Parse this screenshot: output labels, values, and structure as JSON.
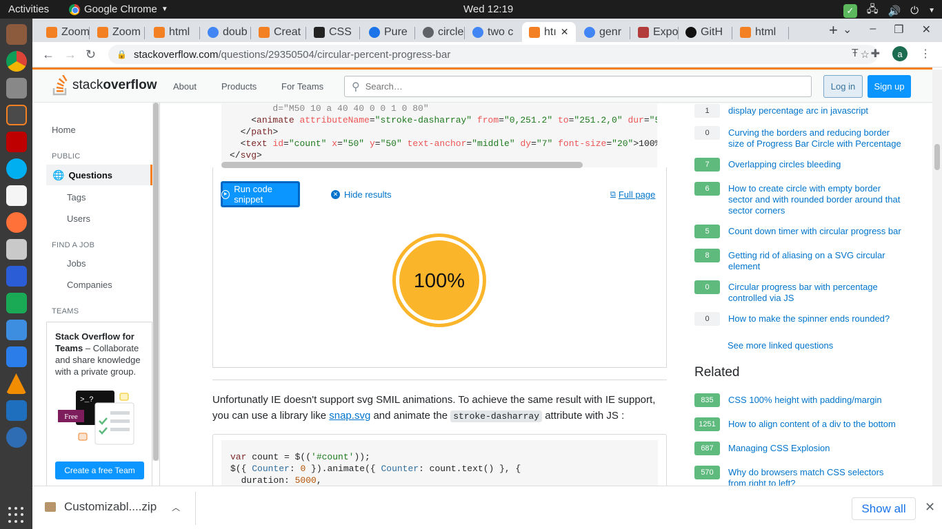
{
  "os_topbar": {
    "activities": "Activities",
    "app_name": "Google Chrome",
    "clock": "Wed 12:19"
  },
  "tabs": [
    {
      "label": "Zoom",
      "icon": "zoom-favicon",
      "color": "#f48024"
    },
    {
      "label": "Zoom",
      "icon": "zoom-favicon",
      "color": "#f48024"
    },
    {
      "label": "html",
      "icon": "stackoverflow-favicon",
      "color": "#f48024"
    },
    {
      "label": "doub",
      "icon": "google-favicon",
      "color": "#4285f4"
    },
    {
      "label": "Creat",
      "icon": "stackoverflow-favicon",
      "color": "#f48024"
    },
    {
      "label": "CSS",
      "icon": "codepen-favicon",
      "color": "#222222"
    },
    {
      "label": "Pure",
      "icon": "css-favicon",
      "color": "#1a73e8"
    },
    {
      "label": "circle",
      "icon": "globe-favicon",
      "color": "#5f6368"
    },
    {
      "label": "two c",
      "icon": "google-favicon",
      "color": "#4285f4"
    },
    {
      "label": "htı",
      "icon": "stackoverflow-favicon",
      "color": "#f48024",
      "active": true
    },
    {
      "label": "genr",
      "icon": "google-favicon",
      "color": "#4285f4"
    },
    {
      "label": "Expo",
      "icon": "expo-favicon",
      "color": "#b23b3b"
    },
    {
      "label": "GitH",
      "icon": "github-favicon",
      "color": "#111111"
    },
    {
      "label": "html",
      "icon": "stackoverflow-favicon",
      "color": "#f48024"
    }
  ],
  "address": {
    "domain": "stackoverflow.com",
    "path": "/questions/29350504/circular-percent-progress-bar"
  },
  "profile_initial": "a",
  "so_header": {
    "logo_text_light": "stack",
    "logo_text_bold": "overflow",
    "nav": [
      "About",
      "Products",
      "For Teams"
    ],
    "search_placeholder": "Search…",
    "login": "Log in",
    "signup": "Sign up"
  },
  "left_nav": {
    "home": "Home",
    "public_heading": "PUBLIC",
    "questions": "Questions",
    "tags": "Tags",
    "users": "Users",
    "job_heading": "FIND A JOB",
    "jobs": "Jobs",
    "companies": "Companies",
    "teams_heading": "TEAMS",
    "teams_title": "Stack Overflow for Teams",
    "teams_desc": " – Collaborate and share knowledge with a private group.",
    "create_team": "Create a free Team",
    "teams_badge": "Free"
  },
  "snippet": {
    "run": "Run code snippet",
    "hide": "Hide results",
    "full_page": "Full page",
    "result_text": "100%"
  },
  "answer": {
    "text_before": "Unfortunatly IE doesn't support svg SMIL animations. To achieve the same result with IE support, you can use a library like ",
    "link": "snap.svg",
    "text_mid": " and animate the ",
    "code": "stroke-dasharray",
    "text_after": " attribute with JS :"
  },
  "linked": [
    {
      "score": "1",
      "accepted": false,
      "title": "display percentage arc in javascript"
    },
    {
      "score": "0",
      "accepted": false,
      "title": "Curving the borders and reducing border size of Progress Bar Circle with Percentage"
    },
    {
      "score": "7",
      "accepted": true,
      "title": "Overlapping circles bleeding"
    },
    {
      "score": "6",
      "accepted": true,
      "title": "How to create circle with empty border sector and with rounded border around that sector corners"
    },
    {
      "score": "5",
      "accepted": true,
      "title": "Count down timer with circular progress bar"
    },
    {
      "score": "8",
      "accepted": true,
      "title": "Getting rid of aliasing on a SVG circular element"
    },
    {
      "score": "0",
      "accepted": true,
      "title": "Circular progress bar with percentage controlled via JS"
    },
    {
      "score": "0",
      "accepted": false,
      "title": "How to make the spinner ends rounded?"
    }
  ],
  "see_more": "See more linked questions",
  "related_heading": "Related",
  "related": [
    {
      "score": "835",
      "title": "CSS 100% height with padding/margin"
    },
    {
      "score": "1251",
      "title": "How to align content of a div to the bottom"
    },
    {
      "score": "687",
      "title": "Managing CSS Explosion"
    },
    {
      "score": "570",
      "title": "Why do browsers match CSS selectors from right to left?"
    }
  ],
  "download": {
    "file": "Customizabl....zip",
    "show_all": "Show all"
  },
  "colors": {
    "so_orange": "#f48024",
    "so_blue": "#0a95ff",
    "accepted_green": "#5eba7d",
    "progress_fill": "#fbb52b"
  }
}
